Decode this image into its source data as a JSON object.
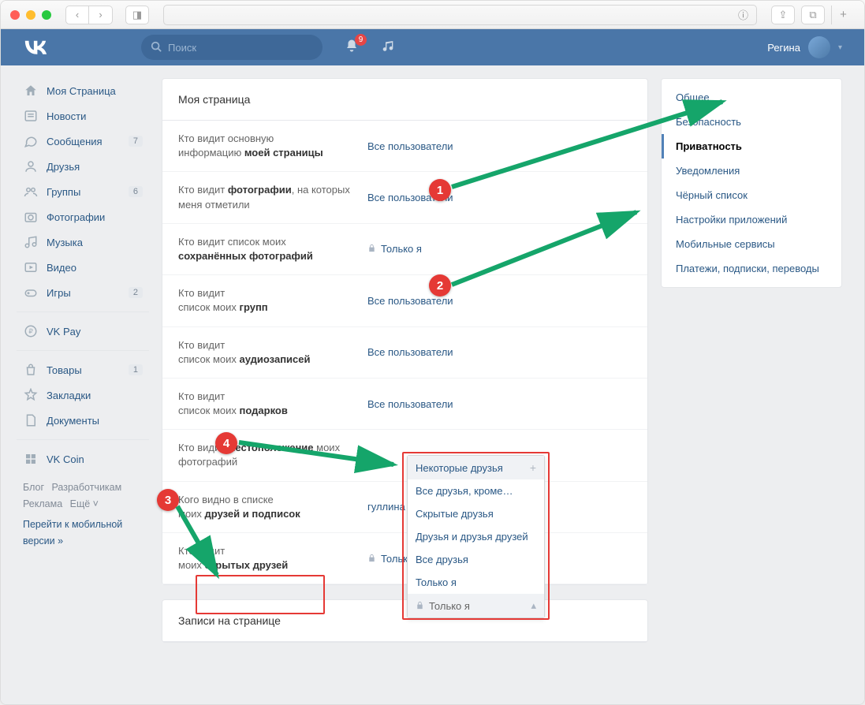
{
  "header": {
    "search_placeholder": "Поиск",
    "notif_count": "9",
    "user_name": "Регина"
  },
  "left_nav": {
    "items": [
      {
        "icon": "home",
        "label": "Моя Страница",
        "count": ""
      },
      {
        "icon": "news",
        "label": "Новости",
        "count": ""
      },
      {
        "icon": "msg",
        "label": "Сообщения",
        "count": "7"
      },
      {
        "icon": "friends",
        "label": "Друзья",
        "count": ""
      },
      {
        "icon": "groups",
        "label": "Группы",
        "count": "6"
      },
      {
        "icon": "photo",
        "label": "Фотографии",
        "count": ""
      },
      {
        "icon": "music",
        "label": "Музыка",
        "count": ""
      },
      {
        "icon": "video",
        "label": "Видео",
        "count": ""
      },
      {
        "icon": "games",
        "label": "Игры",
        "count": "2"
      }
    ],
    "items2": [
      {
        "icon": "pay",
        "label": "VK Pay",
        "count": ""
      }
    ],
    "items3": [
      {
        "icon": "market",
        "label": "Товары",
        "count": "1"
      },
      {
        "icon": "bookmark",
        "label": "Закладки",
        "count": ""
      },
      {
        "icon": "docs",
        "label": "Документы",
        "count": ""
      }
    ],
    "items4": [
      {
        "icon": "coin",
        "label": "VK Coin",
        "count": ""
      }
    ],
    "footer": {
      "blog": "Блог",
      "devs": "Разработчикам",
      "ads": "Реклама",
      "more": "Ещё ˅",
      "mobile": "Перейти к мобильной версии »"
    }
  },
  "settings_nav": [
    "Общее",
    "Безопасность",
    "Приватность",
    "Уведомления",
    "Чёрный список",
    "Настройки приложений",
    "Мобильные сервисы",
    "Платежи, подписки, переводы"
  ],
  "settings_nav_active": 2,
  "content": {
    "title": "Моя страница",
    "second_title": "Записи на странице",
    "rows": [
      {
        "l1": "Кто видит основную",
        "l2": "информацию ",
        "lb": "моей страницы",
        "val": "Все пользователи",
        "lock": false
      },
      {
        "l1": "Кто видит ",
        "lb1": "фотографии",
        "l2": ", на которых меня отметили",
        "val": "Все пользователи",
        "lock": false
      },
      {
        "l1": "Кто видит список моих ",
        "lb": "сохранённых фотографий",
        "val": "Только я",
        "lock": true
      },
      {
        "l1": "Кто видит",
        "l2": "список моих ",
        "lb": "групп",
        "val": "Все пользователи",
        "lock": false
      },
      {
        "l1": "Кто видит",
        "l2": "список моих ",
        "lb": "аудиозаписей",
        "val": "Все пользователи",
        "lock": false
      },
      {
        "l1": "Кто видит",
        "l2": "список моих ",
        "lb": "подарков",
        "val": "Все пользователи",
        "lock": false
      },
      {
        "l1": "Кто видит ",
        "lb1": "местоположение",
        "l2": " моих фотографий",
        "val": "",
        "lock": false
      },
      {
        "l1": "Кого видно в списке",
        "l2": "моих ",
        "lb": "друзей и подписок",
        "val": "гуллина",
        "lock": false
      },
      {
        "l1": "Кто видит",
        "l2": "моих ",
        "lb": "скрытых друзей",
        "val": "Только я",
        "lock": true
      }
    ]
  },
  "dropdown": {
    "items": [
      "Некоторые друзья",
      "Все друзья, кроме…",
      "Скрытые друзья",
      "Друзья и друзья друзей",
      "Все друзья",
      "Только я"
    ],
    "selected": "Только я",
    "highlight": 0
  },
  "annotations": {
    "badges": [
      "1",
      "2",
      "3",
      "4"
    ]
  }
}
